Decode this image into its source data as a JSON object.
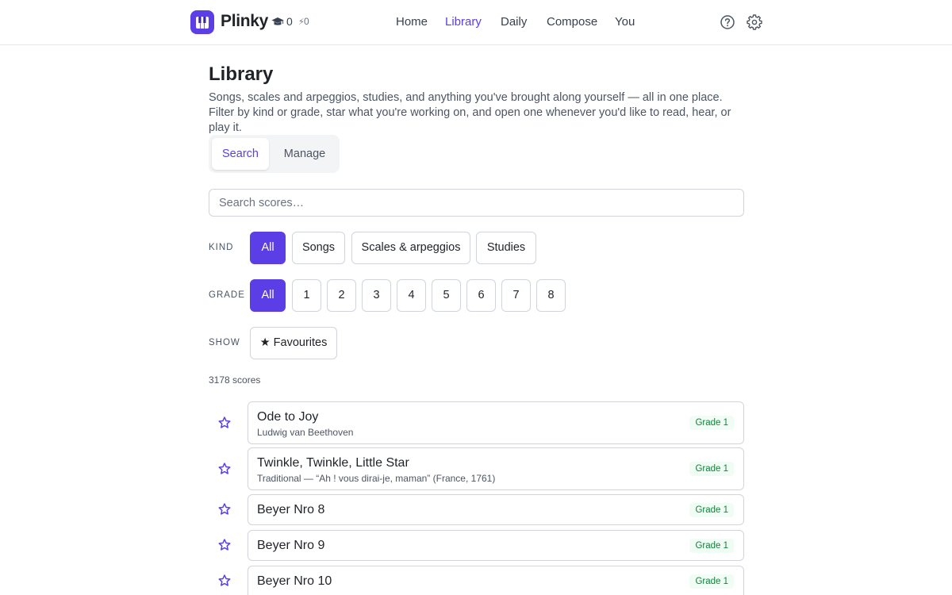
{
  "app": {
    "name": "Plinky",
    "brand_color": "#5b3ee6",
    "logo_icon": "piano-keys-icon",
    "streak_icon": "graduation-cap-icon",
    "streak_count": "0",
    "xp_icon": "bolt-icon",
    "xp_glyph": "⚡",
    "xp_count": "0"
  },
  "nav": {
    "items": [
      {
        "label": "Home"
      },
      {
        "label": "Library",
        "active": true
      },
      {
        "label": "Daily"
      },
      {
        "label": "Compose"
      },
      {
        "label": "You"
      }
    ],
    "help_icon": "help-circle-icon",
    "settings_icon": "gear-icon"
  },
  "page": {
    "title": "Library",
    "description": "Songs, scales and arpeggios, studies, and anything you've brought along yourself — all in one place. Filter by kind or grade, star what you're working on, and open one whenever you'd like to read, hear, or play it."
  },
  "tabs": {
    "search": "Search",
    "manage": "Manage",
    "selected": "Search"
  },
  "search": {
    "placeholder": "Search scores…",
    "value": ""
  },
  "filters": {
    "kind": {
      "label": "KIND",
      "options": [
        "All",
        "Songs",
        "Scales & arpeggios",
        "Studies"
      ],
      "selected": "All"
    },
    "grade": {
      "label": "GRADE",
      "options": [
        "All",
        "1",
        "2",
        "3",
        "4",
        "5",
        "6",
        "7",
        "8"
      ],
      "selected": "All"
    },
    "show": {
      "label": "SHOW",
      "favourites": "★ Favourites"
    }
  },
  "results": {
    "count_text": "3178 scores",
    "star_icon": "star-outline-icon",
    "items": [
      {
        "title": "Ode to Joy",
        "subtitle": "Ludwig van Beethoven",
        "grade": "Grade 1"
      },
      {
        "title": "Twinkle, Twinkle, Little Star",
        "subtitle": "Traditional — “Ah ! vous dirai-je, maman” (France, 1761)",
        "grade": "Grade 1"
      },
      {
        "title": "Beyer Nro 8",
        "subtitle": "",
        "grade": "Grade 1"
      },
      {
        "title": "Beyer Nro 9",
        "subtitle": "",
        "grade": "Grade 1"
      },
      {
        "title": "Beyer Nro 10",
        "subtitle": "",
        "grade": "Grade 1"
      }
    ]
  },
  "colors": {
    "accent": "#5b3ee6",
    "grade_badge_text": "#15803d",
    "grade_badge_bg": "#f0fdf4"
  }
}
